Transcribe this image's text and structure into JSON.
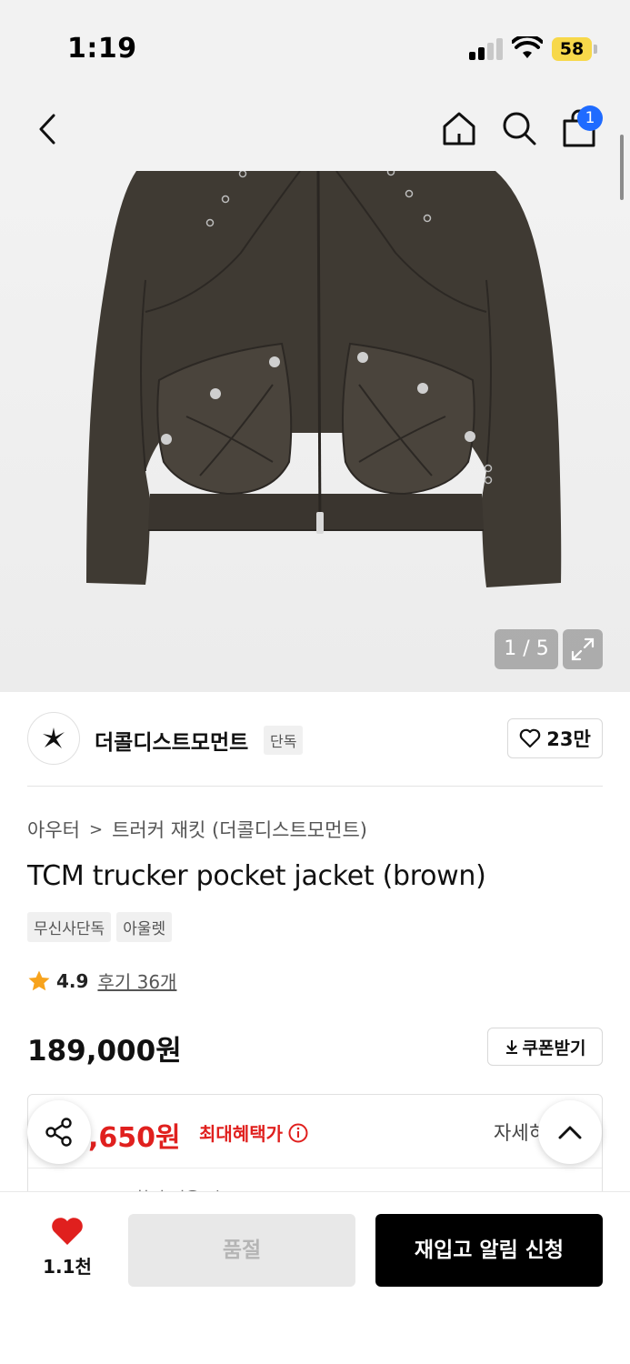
{
  "status_bar": {
    "time": "1:19",
    "battery": "58"
  },
  "header": {
    "cart_count": "1"
  },
  "gallery": {
    "counter": "1 / 5"
  },
  "brand": {
    "name": "더콜디스트모먼트",
    "tag": "단독",
    "likes": "23만"
  },
  "product": {
    "breadcrumb": [
      "아우터",
      "트러커 재킷 (더콜디스트모먼트)"
    ],
    "title": "TCM trucker pocket jacket (brown)",
    "tags": [
      "무신사단독",
      "아울렛"
    ],
    "rating": "4.9",
    "reviews": "후기 36개",
    "price": "189,000원",
    "coupon_label": "쿠폰받기"
  },
  "benefit": {
    "price": ",650원",
    "label": "최대혜택가",
    "detail": "자세히",
    "sub": "...할인 적용 시"
  },
  "bottom_bar": {
    "wish_count": "1.1천",
    "soldout_label": "품절",
    "restock_label": "재입고 알림 신청"
  },
  "colors": {
    "accent_red": "#e0201e",
    "badge_blue": "#1f6bff",
    "battery_yellow": "#f7d84a",
    "jacket_brown": "#3f3a33"
  }
}
